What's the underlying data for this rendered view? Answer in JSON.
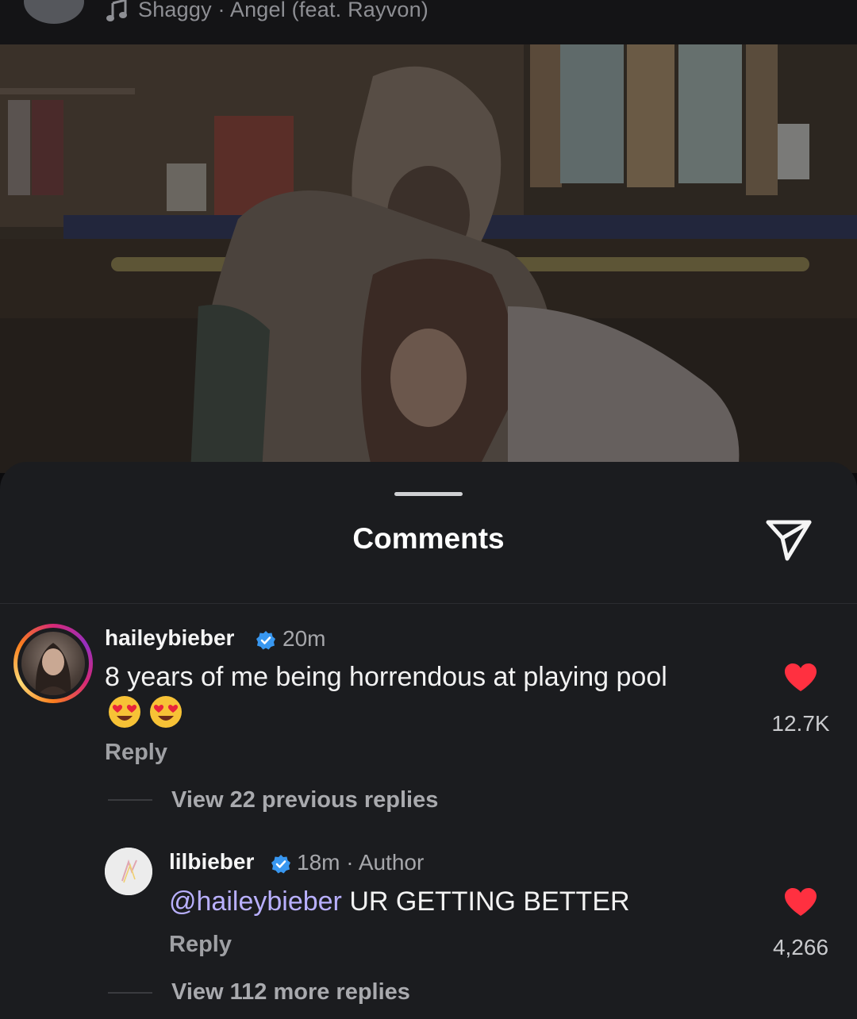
{
  "music": {
    "text": "Shaggy · Angel (feat. Rayvon)"
  },
  "sheet": {
    "title": "Comments"
  },
  "comments": [
    {
      "username": "haileybieber",
      "time": "20m",
      "text": "8 years of me being horrendous at playing pool",
      "emojis": [
        "😍",
        "😍"
      ],
      "reply_label": "Reply",
      "likes": "12.7K",
      "view_replies": "View 22 previous replies"
    },
    {
      "username": "lilbieber",
      "time": "18m",
      "tag": "Author",
      "mention": "@haileybieber",
      "text": "UR GETTING BETTER",
      "reply_label": "Reply",
      "likes": "4,266",
      "view_replies": "View 112 more replies"
    }
  ],
  "colors": {
    "accent_verified": "#3897f0",
    "like_red": "#ff3040",
    "mention": "#b9b0ff"
  },
  "icons": [
    "music-note-icon",
    "send-icon",
    "verified-badge-icon",
    "heart-icon"
  ]
}
